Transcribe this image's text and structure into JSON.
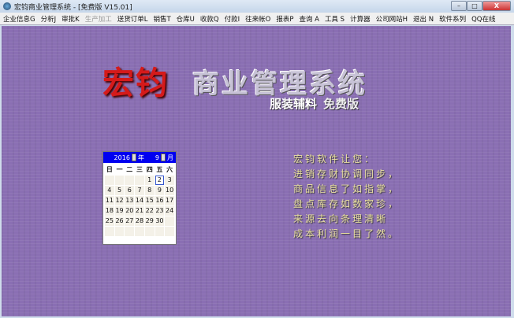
{
  "window": {
    "title": "宏钧商业管理系统 - [免费版 V15.01]",
    "minimize": "–",
    "maximize": "□",
    "close": "X"
  },
  "menu": [
    {
      "label": "企业信息G",
      "enabled": true
    },
    {
      "label": "分析J",
      "enabled": true
    },
    {
      "label": "审批K",
      "enabled": true
    },
    {
      "label": "生产加工",
      "enabled": false
    },
    {
      "label": "送货订单L",
      "enabled": true
    },
    {
      "label": "销售T",
      "enabled": true
    },
    {
      "label": "仓库U",
      "enabled": true
    },
    {
      "label": "收款Q",
      "enabled": true
    },
    {
      "label": "付款I",
      "enabled": true
    },
    {
      "label": "往来帐O",
      "enabled": true
    },
    {
      "label": "报表P",
      "enabled": true
    },
    {
      "label": "查询 A",
      "enabled": true
    },
    {
      "label": "工具 S",
      "enabled": true
    },
    {
      "label": "计算器",
      "enabled": true
    },
    {
      "label": "公司网站H",
      "enabled": true
    },
    {
      "label": "退出 N",
      "enabled": true
    },
    {
      "label": "软件系列",
      "enabled": true
    },
    {
      "label": "QQ在线",
      "enabled": true
    }
  ],
  "banner": {
    "brand": "宏钧",
    "product": "商业管理系统",
    "edition": "服装辅料",
    "free": "免费版"
  },
  "slogan": [
    "宏钧软件让您：",
    "进销存财协调同步，",
    "商品信息了如指掌，",
    "盘点库存如数家珍，",
    "来源去向条理清晰",
    "成本利润一目了然。"
  ],
  "calendar": {
    "year": "2016",
    "year_label": "年",
    "month": "9",
    "month_label": "月",
    "weekdays": [
      "日",
      "一",
      "二",
      "三",
      "四",
      "五",
      "六"
    ],
    "leading_blanks": 4,
    "days": 30,
    "selected": 2,
    "trailing_blanks": 8
  }
}
